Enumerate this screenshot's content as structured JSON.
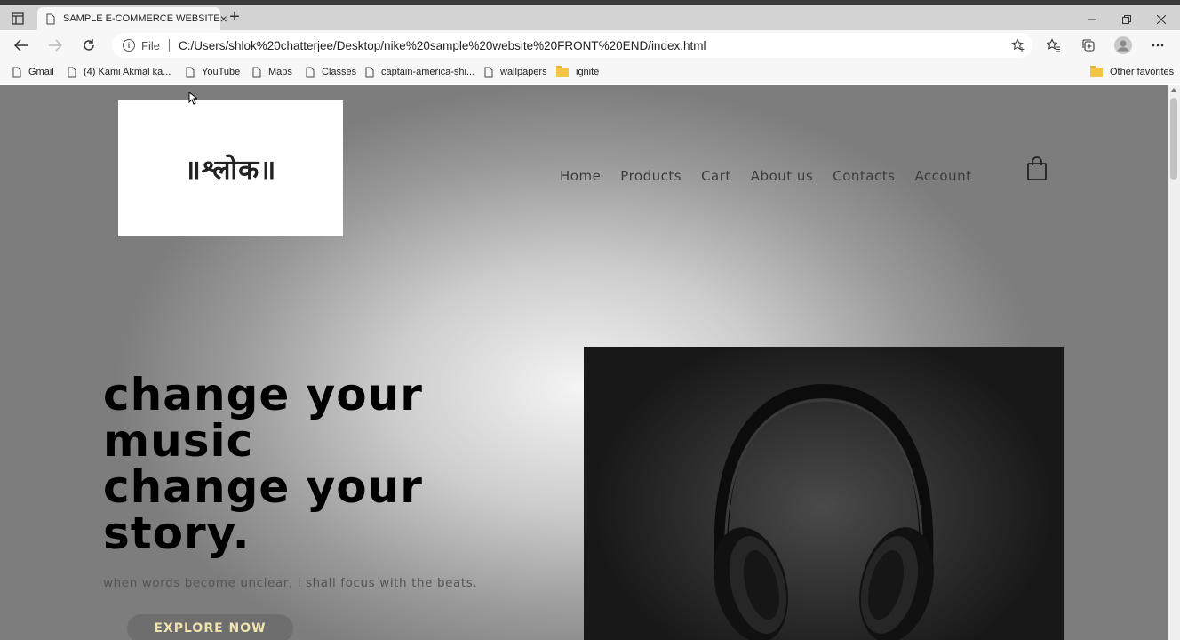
{
  "browser": {
    "tab_title": "SAMPLE E-COMMERCE WEBSITE",
    "url_scheme": "File",
    "url": "C:/Users/shlok%20chatterjee/Desktop/nike%20sample%20website%20FRONT%20END/index.html",
    "new_tab": "+",
    "close_tab": "×",
    "bookmarks": [
      {
        "label": "Gmail",
        "type": "page"
      },
      {
        "label": "(4) Kami Akmal ka...",
        "type": "page"
      },
      {
        "label": "YouTube",
        "type": "page"
      },
      {
        "label": "Maps",
        "type": "page"
      },
      {
        "label": "Classes",
        "type": "page"
      },
      {
        "label": "captain-america-shi...",
        "type": "page"
      },
      {
        "label": "wallpapers",
        "type": "page"
      },
      {
        "label": "ignite",
        "type": "folder"
      }
    ],
    "other_favorites": "Other favorites"
  },
  "site": {
    "logo_text": "॥श्लोक॥",
    "nav": [
      "Home",
      "Products",
      "Cart",
      "About us",
      "Contacts",
      "Account"
    ],
    "headline": [
      "change your",
      "music",
      "change your",
      "story."
    ],
    "tagline": "when words become unclear, i shall focus with the beats.",
    "cta": "EXPLORE NOW"
  },
  "colors": {
    "accent_button_text": "#f0e3b0",
    "button_bg": "#6e6e6e",
    "headline": "#000000"
  }
}
